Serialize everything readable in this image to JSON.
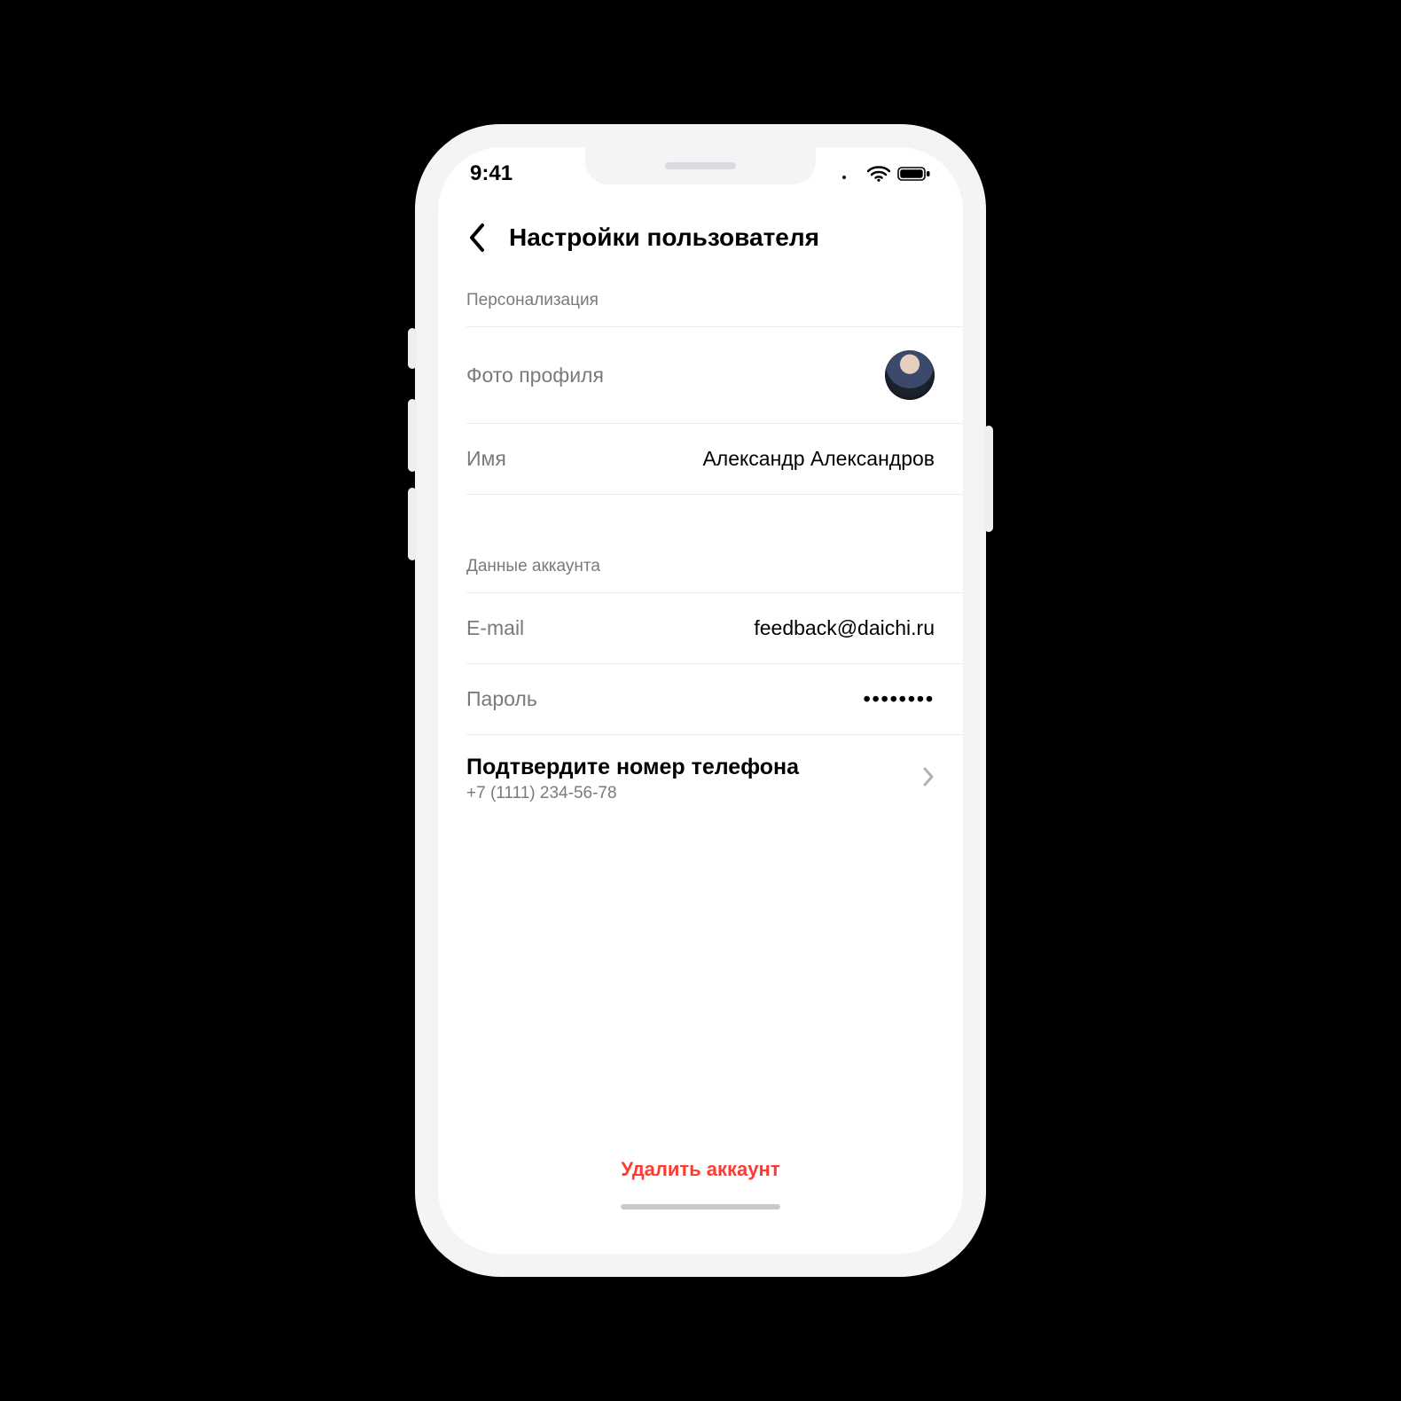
{
  "status": {
    "time": "9:41"
  },
  "header": {
    "title": "Настройки пользователя"
  },
  "section1": {
    "header": "Персонализация"
  },
  "photo": {
    "label": "Фото профиля"
  },
  "name": {
    "label": "Имя",
    "value": "Александр Александров"
  },
  "section2": {
    "header": "Данные аккаунта"
  },
  "email": {
    "label": "E-mail",
    "value": "feedback@daichi.ru"
  },
  "password": {
    "label": "Пароль",
    "mask": "••••••••"
  },
  "confirm": {
    "title": "Подтвердите номер телефона",
    "sub": "+7 (1111) 234-56-78"
  },
  "footer": {
    "delete": "Удалить аккаунт"
  },
  "colors": {
    "danger": "#ff3b30",
    "muted": "#7a7a7e"
  }
}
